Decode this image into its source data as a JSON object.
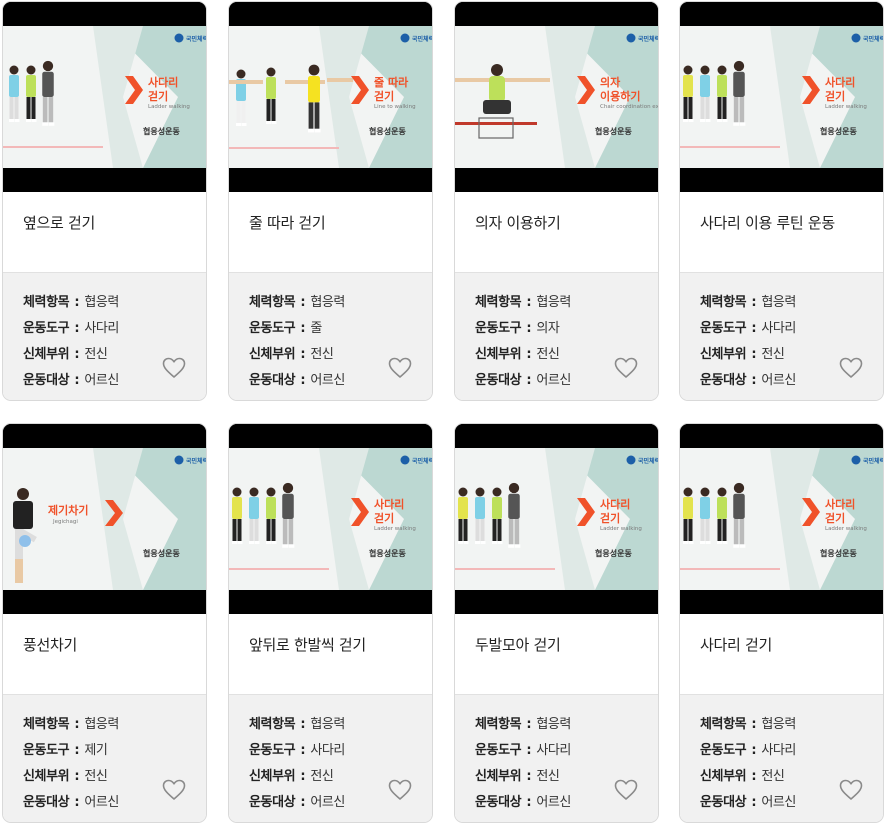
{
  "labels": {
    "fitness_item": "체력항목",
    "equipment": "운동도구",
    "body_part": "신체부위",
    "target": "운동대상",
    "separator": " : "
  },
  "brand_logo_text": "국민체력",
  "brand_logo_sub": "100 Fitness & Health",
  "colors": {
    "accent_orange": "#f0522a",
    "banner_teal": "#bcd8d2",
    "banner_bg": "#f2f4f3",
    "letterbox": "#000000",
    "info_bg": "#f1f1f1",
    "heart_stroke": "#8a8a8a"
  },
  "icons": {
    "favorite": "heart-outline-icon",
    "logo": "fitness-logo-icon"
  },
  "cards": [
    {
      "title": "옆으로 걷기",
      "fitness_item": "협응력",
      "equipment": "사다리",
      "body_part": "전신",
      "target": "어르신",
      "banner_title": "사다리 걷기",
      "banner_sub": "Ladder walking",
      "banner_tag": "협응성운동"
    },
    {
      "title": "줄 따라 걷기",
      "fitness_item": "협응력",
      "equipment": "줄",
      "body_part": "전신",
      "target": "어르신",
      "banner_title": "줄 따라 걷기",
      "banner_sub": "Line to walking",
      "banner_tag": "협응성운동"
    },
    {
      "title": "의자 이용하기",
      "fitness_item": "협응력",
      "equipment": "의자",
      "body_part": "전신",
      "target": "어르신",
      "banner_title": "의자 이용하기",
      "banner_sub": "Chair coordination exercise",
      "banner_tag": "협응성운동"
    },
    {
      "title": "사다리 이용 루틴 운동",
      "fitness_item": "협응력",
      "equipment": "사다리",
      "body_part": "전신",
      "target": "어르신",
      "banner_title": "사다리 걷기",
      "banner_sub": "Ladder walking",
      "banner_tag": "협응성운동"
    },
    {
      "title": "풍선차기",
      "fitness_item": "협응력",
      "equipment": "제기",
      "body_part": "전신",
      "target": "어르신",
      "banner_title": "제기차기",
      "banner_sub": "Jegichagi",
      "banner_tag": "협응성운동"
    },
    {
      "title": "앞뒤로 한발씩 걷기",
      "fitness_item": "협응력",
      "equipment": "사다리",
      "body_part": "전신",
      "target": "어르신",
      "banner_title": "사다리 걷기",
      "banner_sub": "Ladder walking",
      "banner_tag": "협응성운동"
    },
    {
      "title": "두발모아 걷기",
      "fitness_item": "협응력",
      "equipment": "사다리",
      "body_part": "전신",
      "target": "어르신",
      "banner_title": "사다리 걷기",
      "banner_sub": "Ladder walking",
      "banner_tag": "협응성운동"
    },
    {
      "title": "사다리 걷기",
      "fitness_item": "협응력",
      "equipment": "사다리",
      "body_part": "전신",
      "target": "어르신",
      "banner_title": "사다리 걷기",
      "banner_sub": "Ladder walking",
      "banner_tag": "협응성운동"
    }
  ]
}
